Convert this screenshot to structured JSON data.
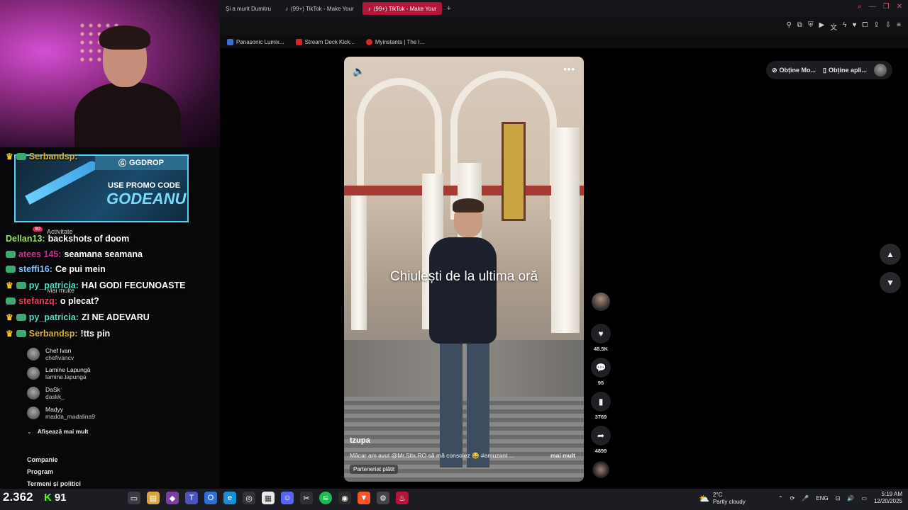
{
  "browser": {
    "tabs": [
      {
        "label": "Și a murit Dumitru",
        "active": false
      },
      {
        "label": "(99+) TikTok - Make Your",
        "active": false
      },
      {
        "label": "(99+) TikTok - Make Your",
        "active": true
      }
    ],
    "new_tab": "+",
    "bookmarks": [
      {
        "label": "Panasonic Lumix...",
        "color": "#3b6fd1"
      },
      {
        "label": "Stream Deck Kick...",
        "color": "#e02020"
      },
      {
        "label": "Myinstants | The I...",
        "color": "#d12b2b"
      }
    ]
  },
  "tiktok": {
    "pills": {
      "item1": "Obține Mo...",
      "item2": "Obține apli..."
    },
    "caption": "Chiulești de la ultima oră",
    "author": "tzupa",
    "description": "Măcar am avut @Mr.Stix.RO să mă consolez 😂 #amuzant ...",
    "more": "mai mult",
    "partner_tag": "Parteneriat plătit",
    "likes": "48.5K",
    "comments": "95",
    "saves": "3769",
    "shares": "4899"
  },
  "promo": {
    "brand": "GGDROP",
    "line1": "USE PROMO CODE",
    "line2": "GODEANU"
  },
  "tiktok_sidebar": {
    "activity": "Activitate",
    "activity_count": "90",
    "more": "Mai multe",
    "following": [
      {
        "name": "Chef Ivan",
        "user": "chefivancv"
      },
      {
        "name": "Lamine Lapungă",
        "user": "lamine.lapunga"
      },
      {
        "name": "DaSk",
        "user": "daskk_"
      },
      {
        "name": "Madyy",
        "user": "madda_madalina9"
      }
    ],
    "show_more": "Afișează mai mult",
    "company": "Companie",
    "program": "Program",
    "terms": "Termeni și politici"
  },
  "chat": [
    {
      "user": "Serbandsp:",
      "msg": "",
      "color": "#d8b13a"
    },
    {
      "user": "Dellan13:",
      "msg": "backshots of doom",
      "color": "#9be36a"
    },
    {
      "user": "atees 145:",
      "msg": "seamana seamana",
      "color": "#c7348f"
    },
    {
      "user": "steffi16:",
      "msg": "Ce pui mein",
      "color": "#7cc4ff"
    },
    {
      "user": "py_patricia:",
      "msg": "HAI GODI FECUNOASTE",
      "color": "#4fe0c0"
    },
    {
      "user": "stefanzq:",
      "msg": "o plecat?",
      "color": "#e0405a"
    },
    {
      "user": "py_patricia:",
      "msg": "ZI NE ADEVARU",
      "color": "#4fe0c0"
    },
    {
      "user": "Serbandsp:",
      "msg": "!tts pin",
      "color": "#d8b13a"
    }
  ],
  "overlay": {
    "viewer_count": "2.362",
    "kick_count": "91"
  },
  "taskbar": {
    "weather_temp": "2°C",
    "weather_desc": "Partly cloudy",
    "lang": "ENG",
    "time": "5:19 AM",
    "date": "12/20/2025"
  }
}
